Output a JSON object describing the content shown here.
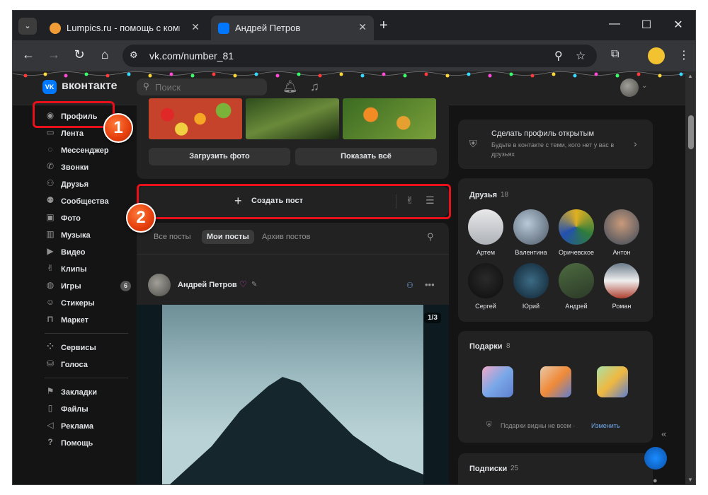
{
  "browser": {
    "tabs": [
      {
        "title": "Lumpics.ru - помощь с компь",
        "favicon": "orange-circle"
      },
      {
        "title": "Андрей Петров",
        "favicon": "vk-logo"
      }
    ],
    "address": "vk.com/number_81"
  },
  "vk": {
    "logo_text": "вконтакте",
    "logo_mark": "VK",
    "search_placeholder": "Поиск",
    "sidebar": [
      {
        "label": "Профиль",
        "icon": "user-icon"
      },
      {
        "label": "Лента",
        "icon": "feed-icon"
      },
      {
        "label": "Мессенджер",
        "icon": "message-icon"
      },
      {
        "label": "Звонки",
        "icon": "phone-icon"
      },
      {
        "label": "Друзья",
        "icon": "friends-icon"
      },
      {
        "label": "Сообщества",
        "icon": "community-icon"
      },
      {
        "label": "Фото",
        "icon": "photo-icon"
      },
      {
        "label": "Музыка",
        "icon": "music-icon"
      },
      {
        "label": "Видео",
        "icon": "video-icon"
      },
      {
        "label": "Клипы",
        "icon": "clips-icon"
      },
      {
        "label": "Игры",
        "icon": "gamepad-icon",
        "badge": "6"
      },
      {
        "label": "Стикеры",
        "icon": "sticker-icon"
      },
      {
        "label": "Маркет",
        "icon": "market-icon"
      },
      {
        "label": "Сервисы",
        "icon": "services-icon"
      },
      {
        "label": "Голоса",
        "icon": "coins-icon"
      },
      {
        "label": "Закладки",
        "icon": "bookmark-icon"
      },
      {
        "label": "Файлы",
        "icon": "file-icon"
      },
      {
        "label": "Реклама",
        "icon": "megaphone-icon"
      },
      {
        "label": "Помощь",
        "icon": "help-icon"
      }
    ],
    "photos": {
      "upload_label": "Загрузить фото",
      "show_all_label": "Показать всё"
    },
    "create_post_label": "Создать пост",
    "posts_tabs": [
      "Все посты",
      "Мои посты",
      "Архив постов"
    ],
    "post": {
      "author": "Андрей Петров",
      "counter": "1/3"
    },
    "privacy": {
      "title": "Сделать профиль открытым",
      "subtitle": "Будьте в контакте с теми, кого нет у вас в друзьях"
    },
    "friends": {
      "title": "Друзья",
      "count": "18",
      "list": [
        "Артем",
        "Валентина",
        "Оричевское",
        "Антон",
        "Сергей",
        "Юрий",
        "Андрей",
        "Роман"
      ]
    },
    "gifts": {
      "title": "Подарки",
      "count": "8",
      "note": "Подарки видны не всем ·",
      "change_link": "Изменить"
    },
    "subscriptions": {
      "title": "Подписки",
      "count": "25"
    }
  },
  "annotations": [
    "1",
    "2"
  ],
  "colors": {
    "vk_blue": "#0077ff",
    "highlight_red": "#e8101a",
    "marker_orange": "#e53e0c",
    "link_blue": "#71aaeb"
  }
}
